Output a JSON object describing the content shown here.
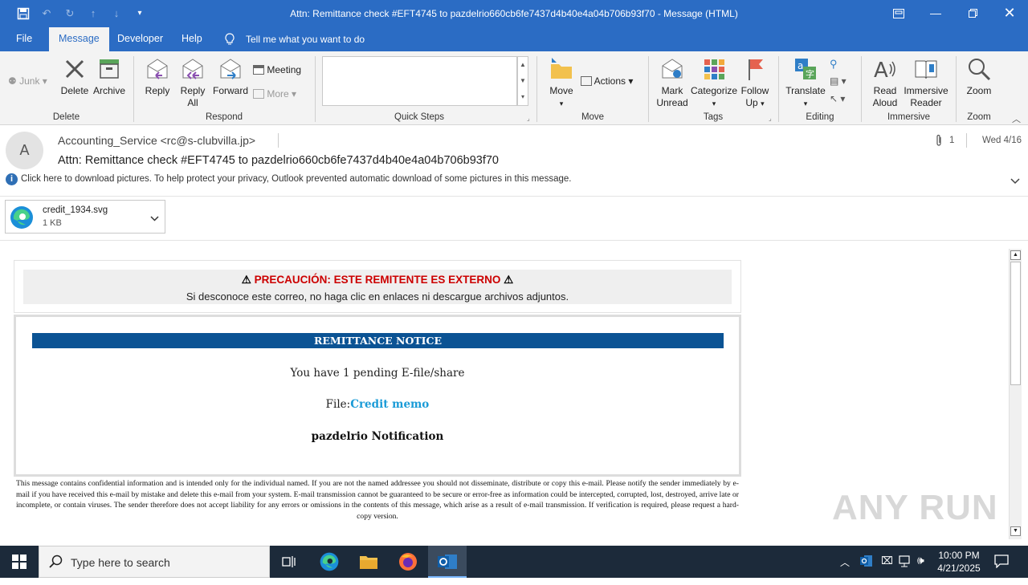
{
  "window": {
    "title": "Attn: Remittance check #EFT4745 to pazdelrio660cb6fe7437d4b40e4a04b706b93f70  -  Message (HTML)"
  },
  "menu_tabs": [
    "File",
    "Message",
    "Developer",
    "Help"
  ],
  "tell_me": "Tell me what you want to do",
  "ribbon": {
    "junk": "Junk",
    "delete": "Delete",
    "archive": "Archive",
    "group_delete": "Delete",
    "reply": "Reply",
    "reply_all_1": "Reply",
    "reply_all_2": "All",
    "forward": "Forward",
    "meeting": "Meeting",
    "more": "More",
    "group_respond": "Respond",
    "group_quicksteps": "Quick Steps",
    "move": "Move",
    "actions": "Actions",
    "group_move": "Move",
    "mark_unread_1": "Mark",
    "mark_unread_2": "Unread",
    "categorize": "Categorize",
    "follow_up_1": "Follow",
    "follow_up_2": "Up",
    "group_tags": "Tags",
    "translate": "Translate",
    "group_editing": "Editing",
    "read_aloud_1": "Read",
    "read_aloud_2": "Aloud",
    "immersive_1": "Immersive",
    "immersive_2": "Reader",
    "group_immersive": "Immersive",
    "zoom": "Zoom",
    "group_zoom": "Zoom"
  },
  "message": {
    "avatar_letter": "A",
    "sender": "Accounting_Service <rc@s-clubvilla.jp>",
    "subject": "Attn: Remittance check #EFT4745 to pazdelrio660cb6fe7437d4b40e4a04b706b93f70",
    "attachment_count": "1",
    "date": "Wed 4/16",
    "info_bar": "Click here to download pictures. To help protect your privacy, Outlook prevented automatic download of some pictures in this message.",
    "attachment": {
      "name": "credit_1934.svg",
      "size": "1 KB"
    }
  },
  "email_body": {
    "caution_title": "PRECAUCIÓN: ESTE REMITENTE ES EXTERNO",
    "caution_text": "Si desconoce este correo, no haga clic en enlaces ni descargue archivos adjuntos.",
    "banner": "REMITTANCE NOTICE",
    "pending": "You have 1 pending E-file/share",
    "file_label": "File:",
    "file_link": "Credit memo",
    "notification": "pazdelrio Notification",
    "disclaimer": "This message contains confidential information and is intended only for the individual named. If you are not the named addressee you should not disseminate, distribute or copy this e-mail. Please notify the sender immediately by e-mail if you have received this e-mail by mistake and delete this e-mail from your system. E-mail transmission cannot be guaranteed to be secure or error-free as information could be intercepted, corrupted, lost, destroyed, arrive late or incomplete, or contain viruses. The sender therefore does not accept liability for any errors or omissions in the contents of this message, which arise as a result of e-mail transmission. If verification is required, please request a hard-copy version."
  },
  "watermark": "ANY RUN",
  "taskbar": {
    "search_placeholder": "Type here to search",
    "time": "10:00 PM",
    "date": "4/21/2025"
  },
  "colors": {
    "titlebar": "#2b6cc4",
    "banner": "#0b5394",
    "caution_red": "#cc0000",
    "link": "#1a9bd7",
    "taskbar": "#1c2a3a"
  }
}
